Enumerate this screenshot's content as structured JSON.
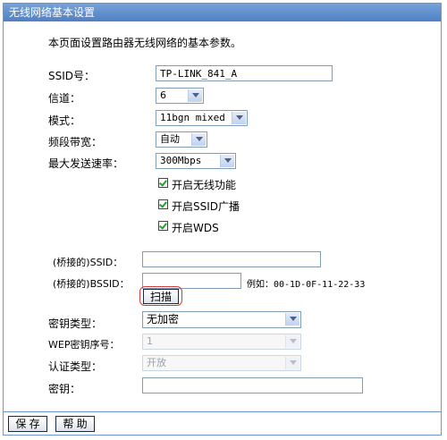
{
  "window": {
    "title": "无线网络基本设置"
  },
  "intro": "本页面设置路由器无线网络的基本参数。",
  "fields": {
    "ssid_label": "SSID号：",
    "ssid_value": "TP-LINK_841_A",
    "channel_label": "信道：",
    "channel_value": "6",
    "mode_label": "模式：",
    "mode_value": "11bgn mixed",
    "bandwidth_label": "频段带宽：",
    "bandwidth_value": "自动",
    "max_rate_label": "最大发送速率：",
    "max_rate_value": "300Mbps"
  },
  "checkboxes": {
    "wireless": {
      "label": "开启无线功能",
      "checked": true
    },
    "ssid_broadcast": {
      "label": "开启SSID广播",
      "checked": true
    },
    "wds": {
      "label": "开启WDS",
      "checked": true
    }
  },
  "wds": {
    "bridged_ssid_label": "(桥接的)SSID：",
    "bridged_ssid_value": "",
    "bridged_bssid_label": "(桥接的)BSSID：",
    "bridged_bssid_value": "",
    "example": "例如：00-1D-0F-11-22-33",
    "scan_button": "扫描",
    "key_type_label": "密钥类型：",
    "key_type_value": "无加密",
    "wep_index_label": "WEP密钥序号：",
    "wep_index_value": "1",
    "auth_type_label": "认证类型：",
    "auth_type_value": "开放",
    "key_label": "密钥：",
    "key_value": ""
  },
  "footer": {
    "save": "保 存",
    "help": "帮 助"
  },
  "colors": {
    "title_bar": "#4f80c3",
    "border": "#6d99c8",
    "highlight": "#d43b3b",
    "check": "#21a121"
  }
}
